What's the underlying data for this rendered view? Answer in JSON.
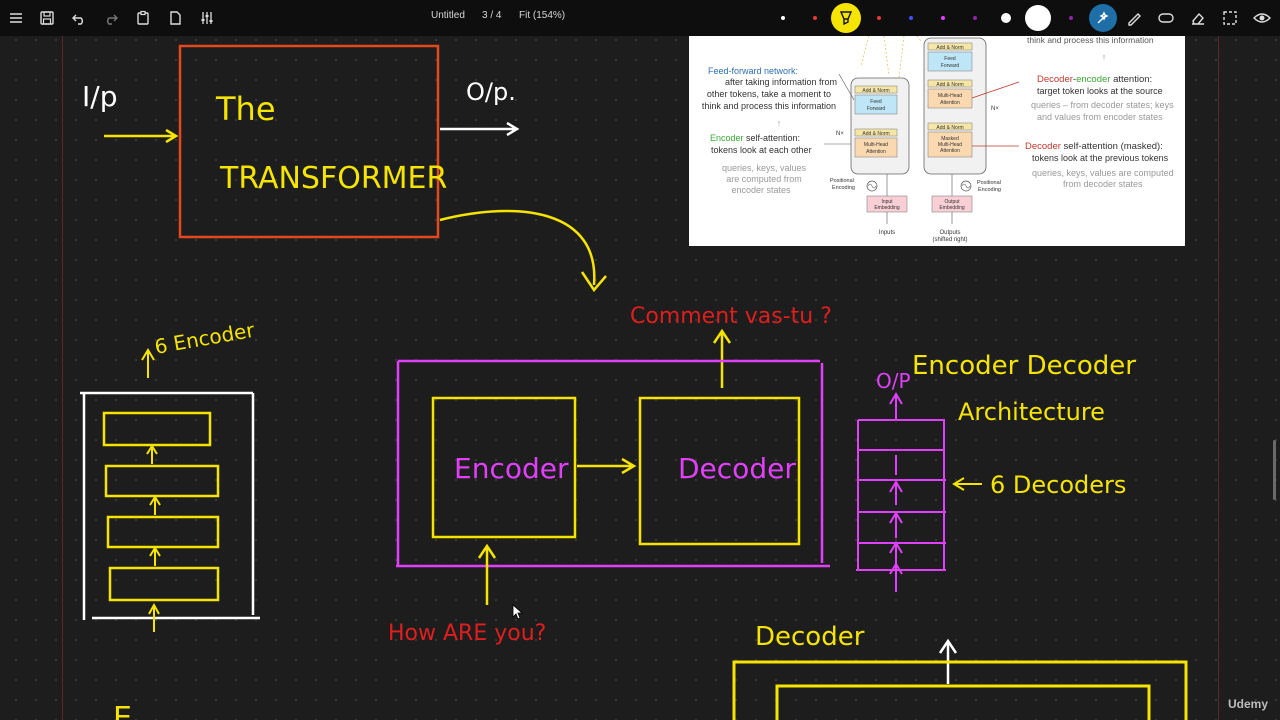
{
  "toolbar": {
    "doc_title": "Untitled",
    "page_indicator": "3 / 4",
    "zoom_label": "Fit (154%)",
    "accent_color": "#f5e400",
    "swatches": [
      "#ffffff",
      "#e53935",
      "#f5e400",
      "#e53935",
      "#3f51ff",
      "#e040fb",
      "#8e24aa",
      "#ffffff"
    ]
  },
  "reference": {
    "top_text": "think and process this information",
    "ff_title": "Feed-forward network:",
    "ff_line1": "after taking information from",
    "ff_line2": "other tokens, take a moment to",
    "ff_line3": "think and process this information",
    "enc_word": "Encoder",
    "enc_rest": " self-attention:",
    "enc_line1": "tokens look at each other",
    "enc_gray1": "queries, keys, values",
    "enc_gray2": "are computed from",
    "enc_gray3": "encoder states",
    "de_word1": "Decoder",
    "de_dash": "-",
    "de_word2": "encoder",
    "de_rest": " attention:",
    "de_line1": "target token looks at the source",
    "de_gray1": "queries – from decoder states; keys",
    "de_gray2": "and values from encoder states",
    "ds_word": "Decoder",
    "ds_rest": " self-attention (masked):",
    "ds_line1": "tokens look at the previous tokens",
    "ds_gray1": "queries, keys, values are computed",
    "ds_gray2": "from decoder states",
    "add_norm": "Add & Norm",
    "feed_forward_1": "Feed",
    "feed_forward_2": "Forward",
    "mha_1": "Multi-Head",
    "mha_2": "Attention",
    "masked_1": "Masked",
    "masked_2": "Multi-Head",
    "masked_3": "Attention",
    "nx": "N×",
    "pos_enc_1": "Positional",
    "pos_enc_2": "Encoding",
    "input_emb_1": "Input",
    "input_emb_2": "Embedding",
    "output_emb_1": "Output",
    "output_emb_2": "Embedding",
    "inputs": "Inputs",
    "outputs_1": "Outputs",
    "outputs_2": "(shifted right)"
  },
  "ink": {
    "ip": "I/p",
    "op": "O/p.",
    "the": "The",
    "transformer": "TRANSFORMER",
    "six_encoder": "6 Encoder",
    "question_top": "Comment vas-tu ?",
    "encoder": "Encoder",
    "decoder": "Decoder",
    "question_bottom": "How ARE you?",
    "op_small": "O/P",
    "enc_dec_title": "Encoder Decoder",
    "architecture": "Architecture",
    "six_decoders": "6 Decoders",
    "decoder_bottom": "Decoder",
    "enc_partial": "E"
  },
  "watermark": "Udemy"
}
